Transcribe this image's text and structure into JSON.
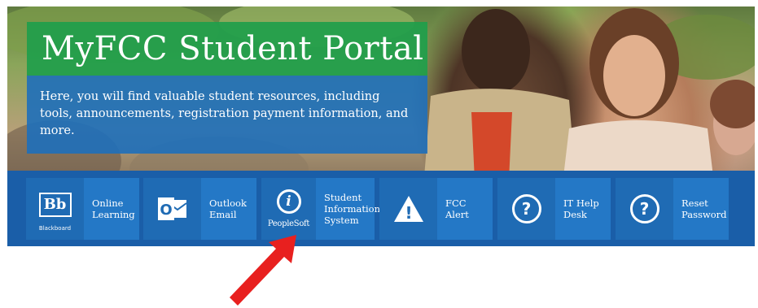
{
  "hero": {
    "title": "MyFCC Student Portal",
    "description": "Here, you will find valuable student resources, including tools, announcements, registration payment information, and more."
  },
  "tiles": [
    {
      "icon": "blackboard-icon",
      "icon_text": "Bb",
      "icon_sub": "Blackboard",
      "label": "Online Learning"
    },
    {
      "icon": "outlook-icon",
      "icon_text": "O",
      "label": "Outlook Email"
    },
    {
      "icon": "peoplesoft-info-icon",
      "icon_text": "i",
      "icon_sub": "PeopleSoft",
      "label": "Student Information System"
    },
    {
      "icon": "alert-warning-icon",
      "icon_text": "!",
      "label": "FCC Alert"
    },
    {
      "icon": "help-question-icon",
      "icon_text": "?",
      "label": "IT Help Desk"
    },
    {
      "icon": "help-question-icon",
      "icon_text": "?",
      "label": "Reset Password"
    }
  ],
  "colors": {
    "title_green": "#1f9e4b",
    "panel_blue": "#1e6fba",
    "bar_blue": "#1a5ea8",
    "tile_blue": "#2478c6",
    "arrow_red": "#e8201f"
  }
}
